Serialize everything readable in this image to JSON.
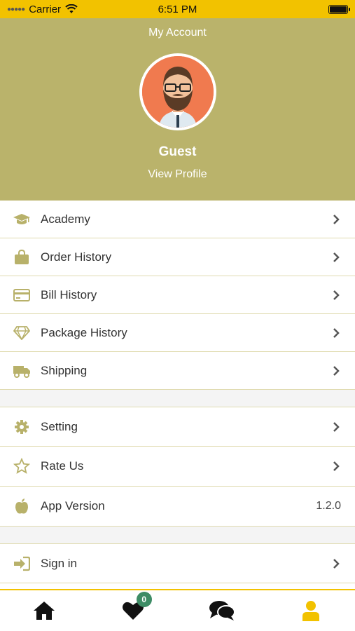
{
  "status_bar": {
    "carrier": "Carrier",
    "time": "6:51 PM"
  },
  "header": {
    "title": "My Account",
    "user_name": "Guest",
    "view_profile": "View Profile"
  },
  "menu_group_1": [
    {
      "label": "Academy",
      "icon": "graduation-cap-icon"
    },
    {
      "label": "Order History",
      "icon": "shopping-bag-icon"
    },
    {
      "label": "Bill History",
      "icon": "credit-card-icon"
    },
    {
      "label": "Package History",
      "icon": "diamond-icon"
    },
    {
      "label": "Shipping",
      "icon": "truck-icon"
    }
  ],
  "menu_group_2": [
    {
      "label": "Setting",
      "icon": "gear-icon"
    },
    {
      "label": "Rate Us",
      "icon": "star-icon"
    },
    {
      "label": "App Version",
      "icon": "apple-icon",
      "value": "1.2.0"
    }
  ],
  "menu_group_3": [
    {
      "label": "Sign in",
      "icon": "sign-in-icon"
    }
  ],
  "tab_bar": {
    "tabs": [
      {
        "name": "home",
        "icon": "home-icon"
      },
      {
        "name": "favorites",
        "icon": "heart-icon",
        "badge": "0"
      },
      {
        "name": "chat",
        "icon": "chat-icon"
      },
      {
        "name": "account",
        "icon": "user-icon",
        "active": true
      }
    ]
  },
  "colors": {
    "header_bg": "#bab36b",
    "accent": "#f2c200",
    "icon": "#b8b16a",
    "badge": "#3d8c65"
  }
}
